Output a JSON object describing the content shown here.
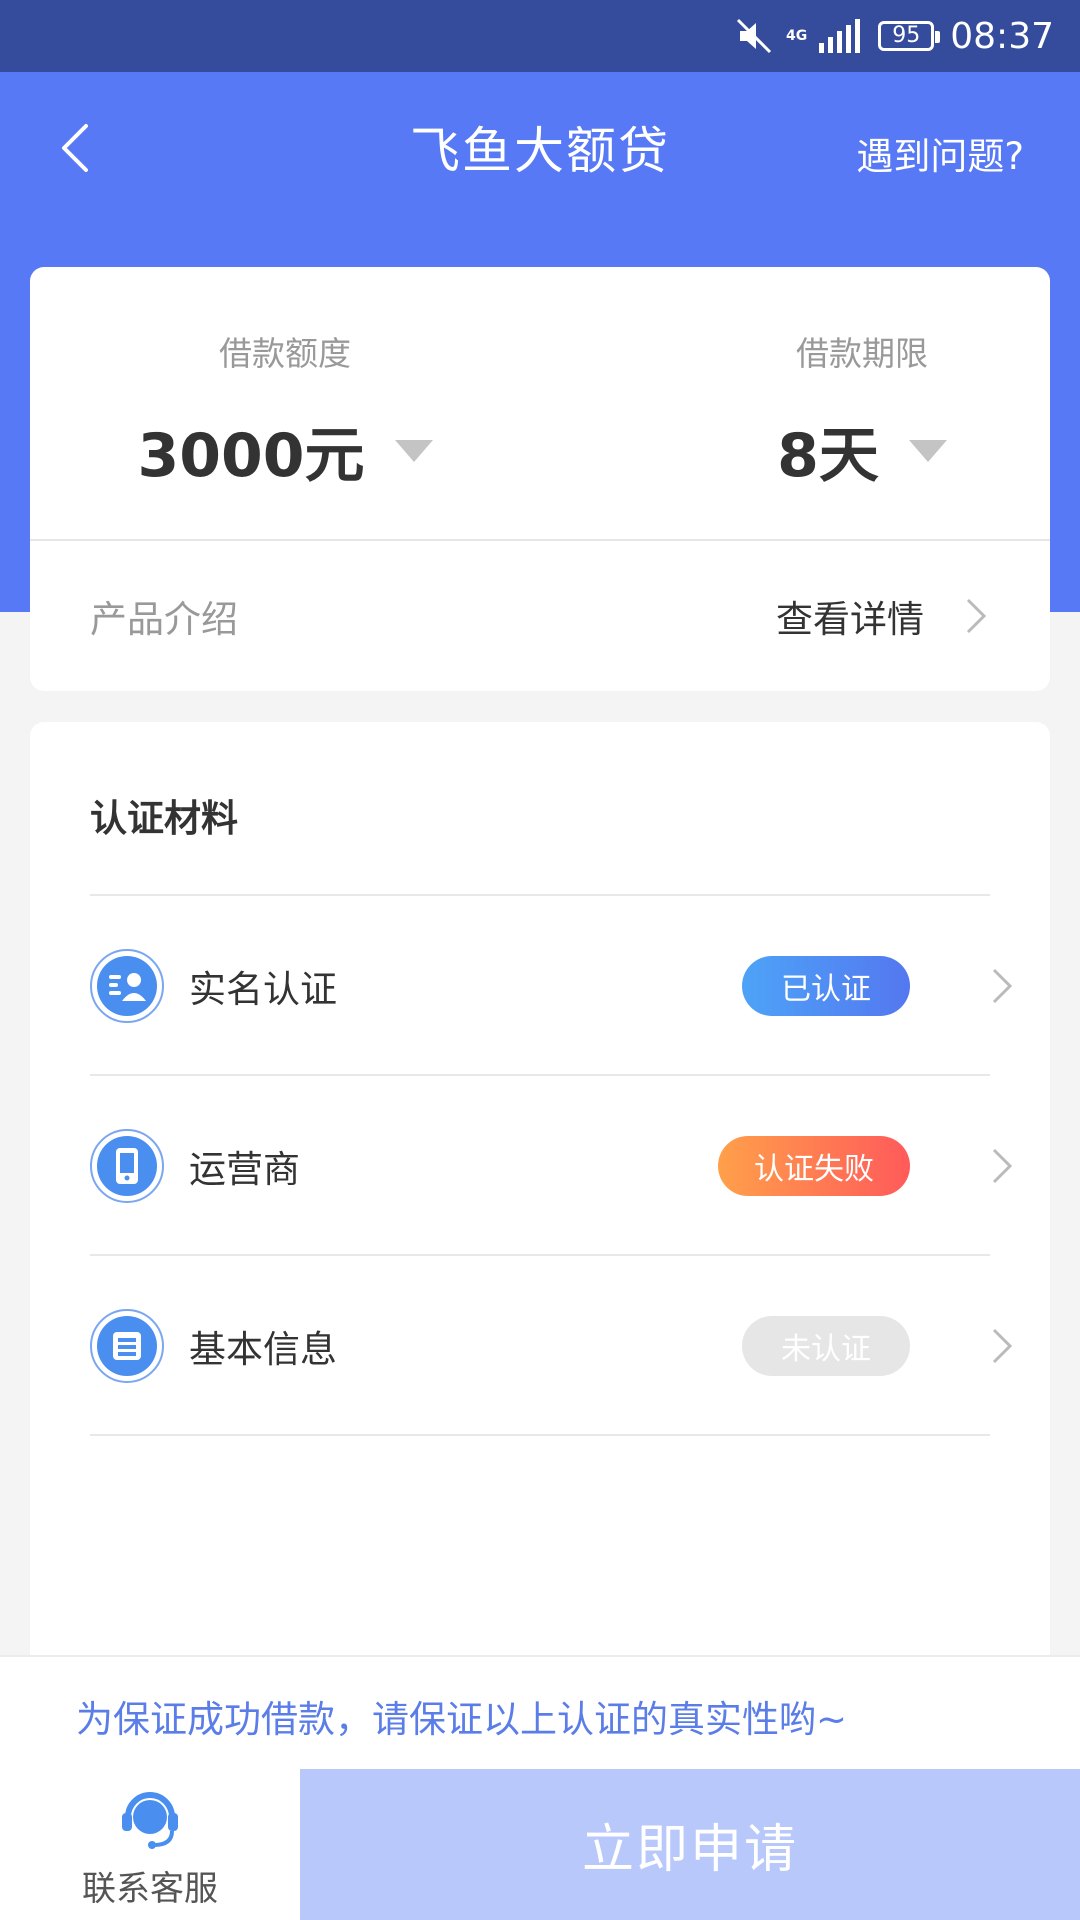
{
  "status_bar": {
    "network": "4G",
    "battery": "95",
    "time": "08:37",
    "icons": [
      "mute-icon",
      "signal-icon",
      "battery-icon"
    ]
  },
  "nav": {
    "title": "飞鱼大额贷",
    "help": "遇到问题?",
    "back_icon": "chevron-left-icon"
  },
  "loan": {
    "amount_label": "借款额度",
    "amount_value": "3000元",
    "term_label": "借款期限",
    "term_value": "8天"
  },
  "product": {
    "label": "产品介绍",
    "link": "查看详情"
  },
  "certification": {
    "title": "认证材料",
    "items": [
      {
        "label": "实名认证",
        "status": "已认证",
        "status_type": "verified",
        "icon": "id-card-icon"
      },
      {
        "label": "运营商",
        "status": "认证失败",
        "status_type": "failed",
        "icon": "phone-icon"
      },
      {
        "label": "基本信息",
        "status": "未认证",
        "status_type": "unverified",
        "icon": "info-card-icon"
      }
    ]
  },
  "notice": "为保证成功借款，请保证以上认证的真实性哟~",
  "bottom": {
    "service_label": "联系客服",
    "apply_label": "立即申请"
  },
  "colors": {
    "header_blue": "#5779f5",
    "status_bar": "#354c9c",
    "verified": "#4da3f7",
    "failed": "#ff7a50",
    "unverified": "#e6e6e6",
    "apply_button": "#b9c8fb",
    "notice_text": "#5b7de8"
  }
}
